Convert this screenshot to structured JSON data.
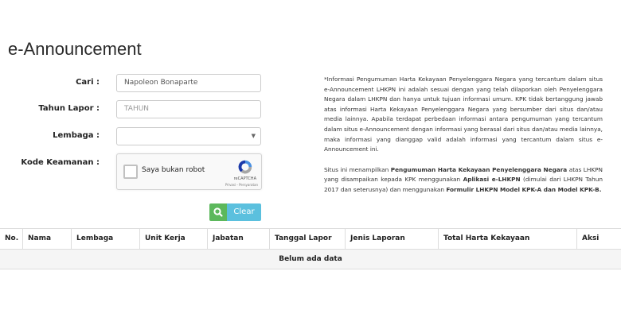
{
  "page": {
    "title": "e-Announcement"
  },
  "form": {
    "cari": {
      "label": "Cari :",
      "value": "Napoleon Bonaparte"
    },
    "tahun_lapor": {
      "label": "Tahun Lapor :",
      "placeholder": "TAHUN"
    },
    "lembaga": {
      "label": "Lembaga :",
      "value": ""
    },
    "kode_keamanan": {
      "label": "Kode Keamanan :"
    },
    "captcha": {
      "checkbox_label": "Saya bukan robot",
      "brand": "reCAPTCHA",
      "links": "Privasi - Persyaratan"
    },
    "buttons": {
      "search_icon": "search-icon",
      "clear_label": "Clear"
    }
  },
  "info": {
    "paragraph1": "*Informasi Pengumuman Harta Kekayaan Penyelenggara Negara yang tercantum dalam situs e-Announcement LHKPN ini adalah sesuai dengan yang telah dilaporkan oleh Penyelenggara Negara dalam LHKPN dan hanya untuk tujuan informasi umum. KPK tidak bertanggung jawab atas informasi Harta Kekayaan Penyelenggara Negara yang bersumber dari situs dan/atau media lainnya. Apabila terdapat perbedaan informasi antara pengumuman yang tercantum dalam situs e-Announcement dengan informasi yang berasal dari situs dan/atau media lainnya, maka informasi yang dianggap valid adalah informasi yang tercantum dalam situs e-Announcement ini.",
    "p2_a": "Situs ini menampilkan ",
    "p2_b": "Pengumuman Harta Kekayaan Penyelenggara Negara",
    "p2_c": " atas LHKPN yang disampaikan kepada KPK menggunakan ",
    "p2_d": "Aplikasi e-LHKPN",
    "p2_e": " (dimulai dari LHKPN Tahun 2017 dan seterusnya) dan menggunakan ",
    "p2_f": "Formulir LHKPN Model KPK-A dan Model KPK-B."
  },
  "table": {
    "columns": [
      "No.",
      "Nama",
      "Lembaga",
      "Unit Kerja",
      "Jabatan",
      "Tanggal Lapor",
      "Jenis Laporan",
      "Total Harta Kekayaan",
      "Aksi"
    ],
    "empty_message": "Belum ada data"
  },
  "colors": {
    "search_button": "#5cb85c",
    "clear_button": "#5bc0de"
  }
}
